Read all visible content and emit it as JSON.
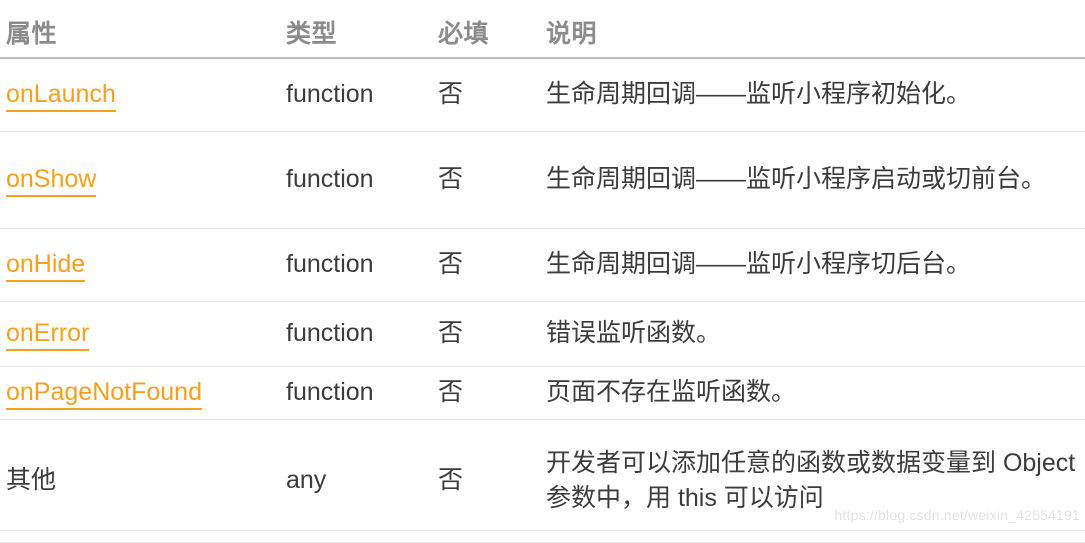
{
  "table": {
    "headers": {
      "property": "属性",
      "type": "类型",
      "required": "必填",
      "description": "说明"
    },
    "rows": [
      {
        "property": "onLaunch",
        "property_is_link": true,
        "type": "function",
        "required": "否",
        "description": "生命周期回调——监听小程序初始化。"
      },
      {
        "property": "onShow",
        "property_is_link": true,
        "type": "function",
        "required": "否",
        "description": "生命周期回调——监听小程序启动或切前台。"
      },
      {
        "property": "onHide",
        "property_is_link": true,
        "type": "function",
        "required": "否",
        "description": "生命周期回调——监听小程序切后台。"
      },
      {
        "property": "onError",
        "property_is_link": true,
        "type": "function",
        "required": "否",
        "description": "错误监听函数。"
      },
      {
        "property": "onPageNotFound",
        "property_is_link": true,
        "type": "function",
        "required": "否",
        "description": "页面不存在监听函数。"
      },
      {
        "property": "其他",
        "property_is_link": false,
        "type": "any",
        "required": "否",
        "description": "开发者可以添加任意的函数或数据变量到 Object 参数中，用 this 可以访问"
      }
    ]
  },
  "watermark": {
    "text": "https://blog.csdn.net/weixin_42554191"
  },
  "colors": {
    "link": "#f5a11e",
    "header_text": "#8c8c8c",
    "body_text": "#3c3c3c",
    "header_rule": "#bdbdbd",
    "row_rule": "#e9e9e9",
    "watermark": "#e3e3e3",
    "background": "#ffffff"
  }
}
